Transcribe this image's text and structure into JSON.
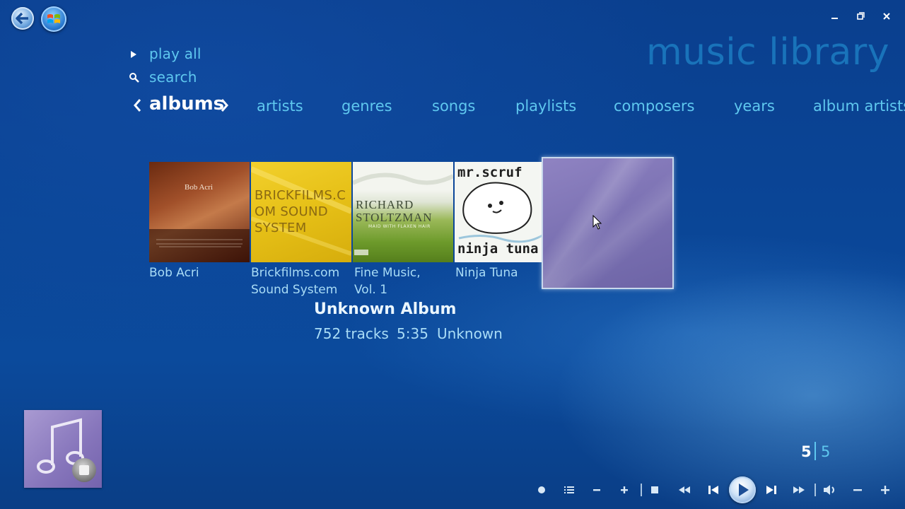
{
  "page_title": "music library",
  "menu": {
    "play_all": "play all",
    "search": "search"
  },
  "pivots": {
    "active": "albums",
    "items": [
      "artists",
      "genres",
      "songs",
      "playlists",
      "composers",
      "years",
      "album artists"
    ]
  },
  "albums": [
    {
      "title": "Bob Acri",
      "cover_text": "Bob Acri"
    },
    {
      "title_line1": "Brickfilms.com",
      "title_line2": "Sound System",
      "cover_text_1": "BRICKFILMS.C",
      "cover_text_2": "OM SOUND",
      "cover_text_3": "SYSTEM"
    },
    {
      "title_line1": "Fine Music,",
      "title_line2": "Vol. 1",
      "cover_text_1": "RICHARD",
      "cover_text_2": "STOLTZMAN",
      "cover_text_3": "MAID WITH FLAXEN HAIR"
    },
    {
      "title": "Ninja Tuna",
      "cover_text_1": "mr.scruf",
      "cover_text_2": "ninja tuna"
    }
  ],
  "selected": {
    "title": "Unknown Album",
    "tracks": "752 tracks",
    "duration": "5:35",
    "artist": "Unknown"
  },
  "counter": {
    "current": "5",
    "total": "5"
  },
  "colors": {
    "accent": "#5fc8ef",
    "title_faint": "#1c7cc2",
    "background": "#0a4596"
  },
  "icons": {
    "back": "back-arrow-icon",
    "start": "windows-orb-icon",
    "transport": [
      "record-icon",
      "playlist-icon",
      "minus-icon",
      "plus-icon",
      "stop-icon",
      "rewind-icon",
      "previous-icon",
      "play-icon",
      "next-icon",
      "fast-forward-icon",
      "volume-icon",
      "volume-down-icon",
      "volume-up-icon"
    ]
  }
}
